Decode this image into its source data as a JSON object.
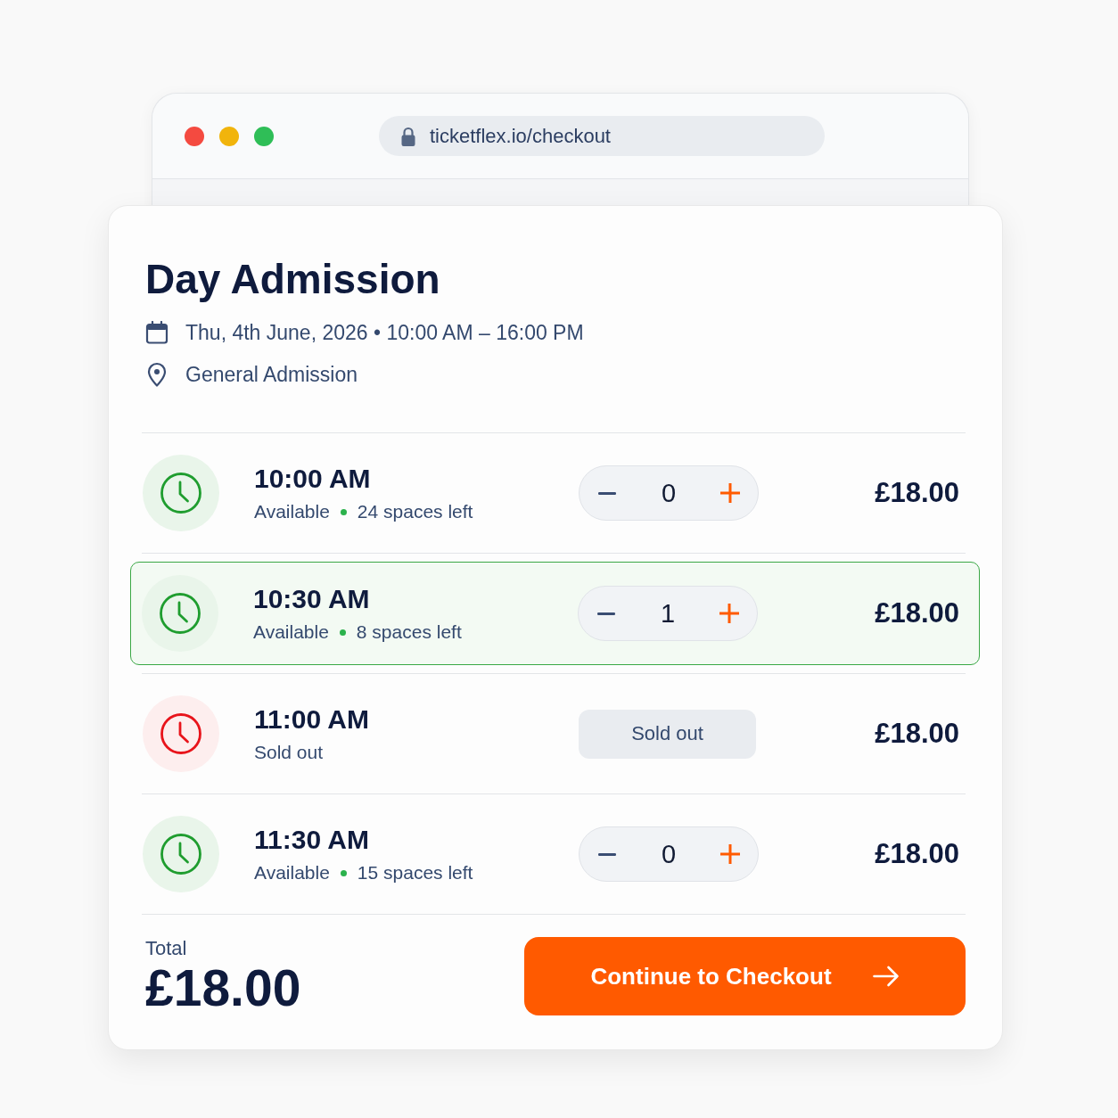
{
  "browser": {
    "url": "ticketflex.io/checkout"
  },
  "event": {
    "title": "Day Admission",
    "date_time": "Thu, 4th June, 2026 • 10:00 AM – 16:00 PM",
    "location": "General Admission"
  },
  "slots": [
    {
      "kind": "available",
      "time": "10:00 AM",
      "availability": "Available",
      "spaces": "24 spaces left",
      "quantity": "0",
      "price": "£18.00",
      "selected": false
    },
    {
      "kind": "available",
      "time": "10:30 AM",
      "availability": "Available",
      "spaces": "8 spaces left",
      "quantity": "1",
      "price": "£18.00",
      "selected": true
    },
    {
      "kind": "sold_out",
      "time": "11:00 AM",
      "availability": "Sold out",
      "badge": "Sold out",
      "price": "£18.00",
      "selected": false
    },
    {
      "kind": "available",
      "time": "11:30 AM",
      "availability": "Available",
      "spaces": "15 spaces left",
      "quantity": "0",
      "price": "£18.00",
      "selected": false
    }
  ],
  "footer": {
    "total_label": "Total",
    "total": "£18.00",
    "button": "Continue to Checkout"
  }
}
